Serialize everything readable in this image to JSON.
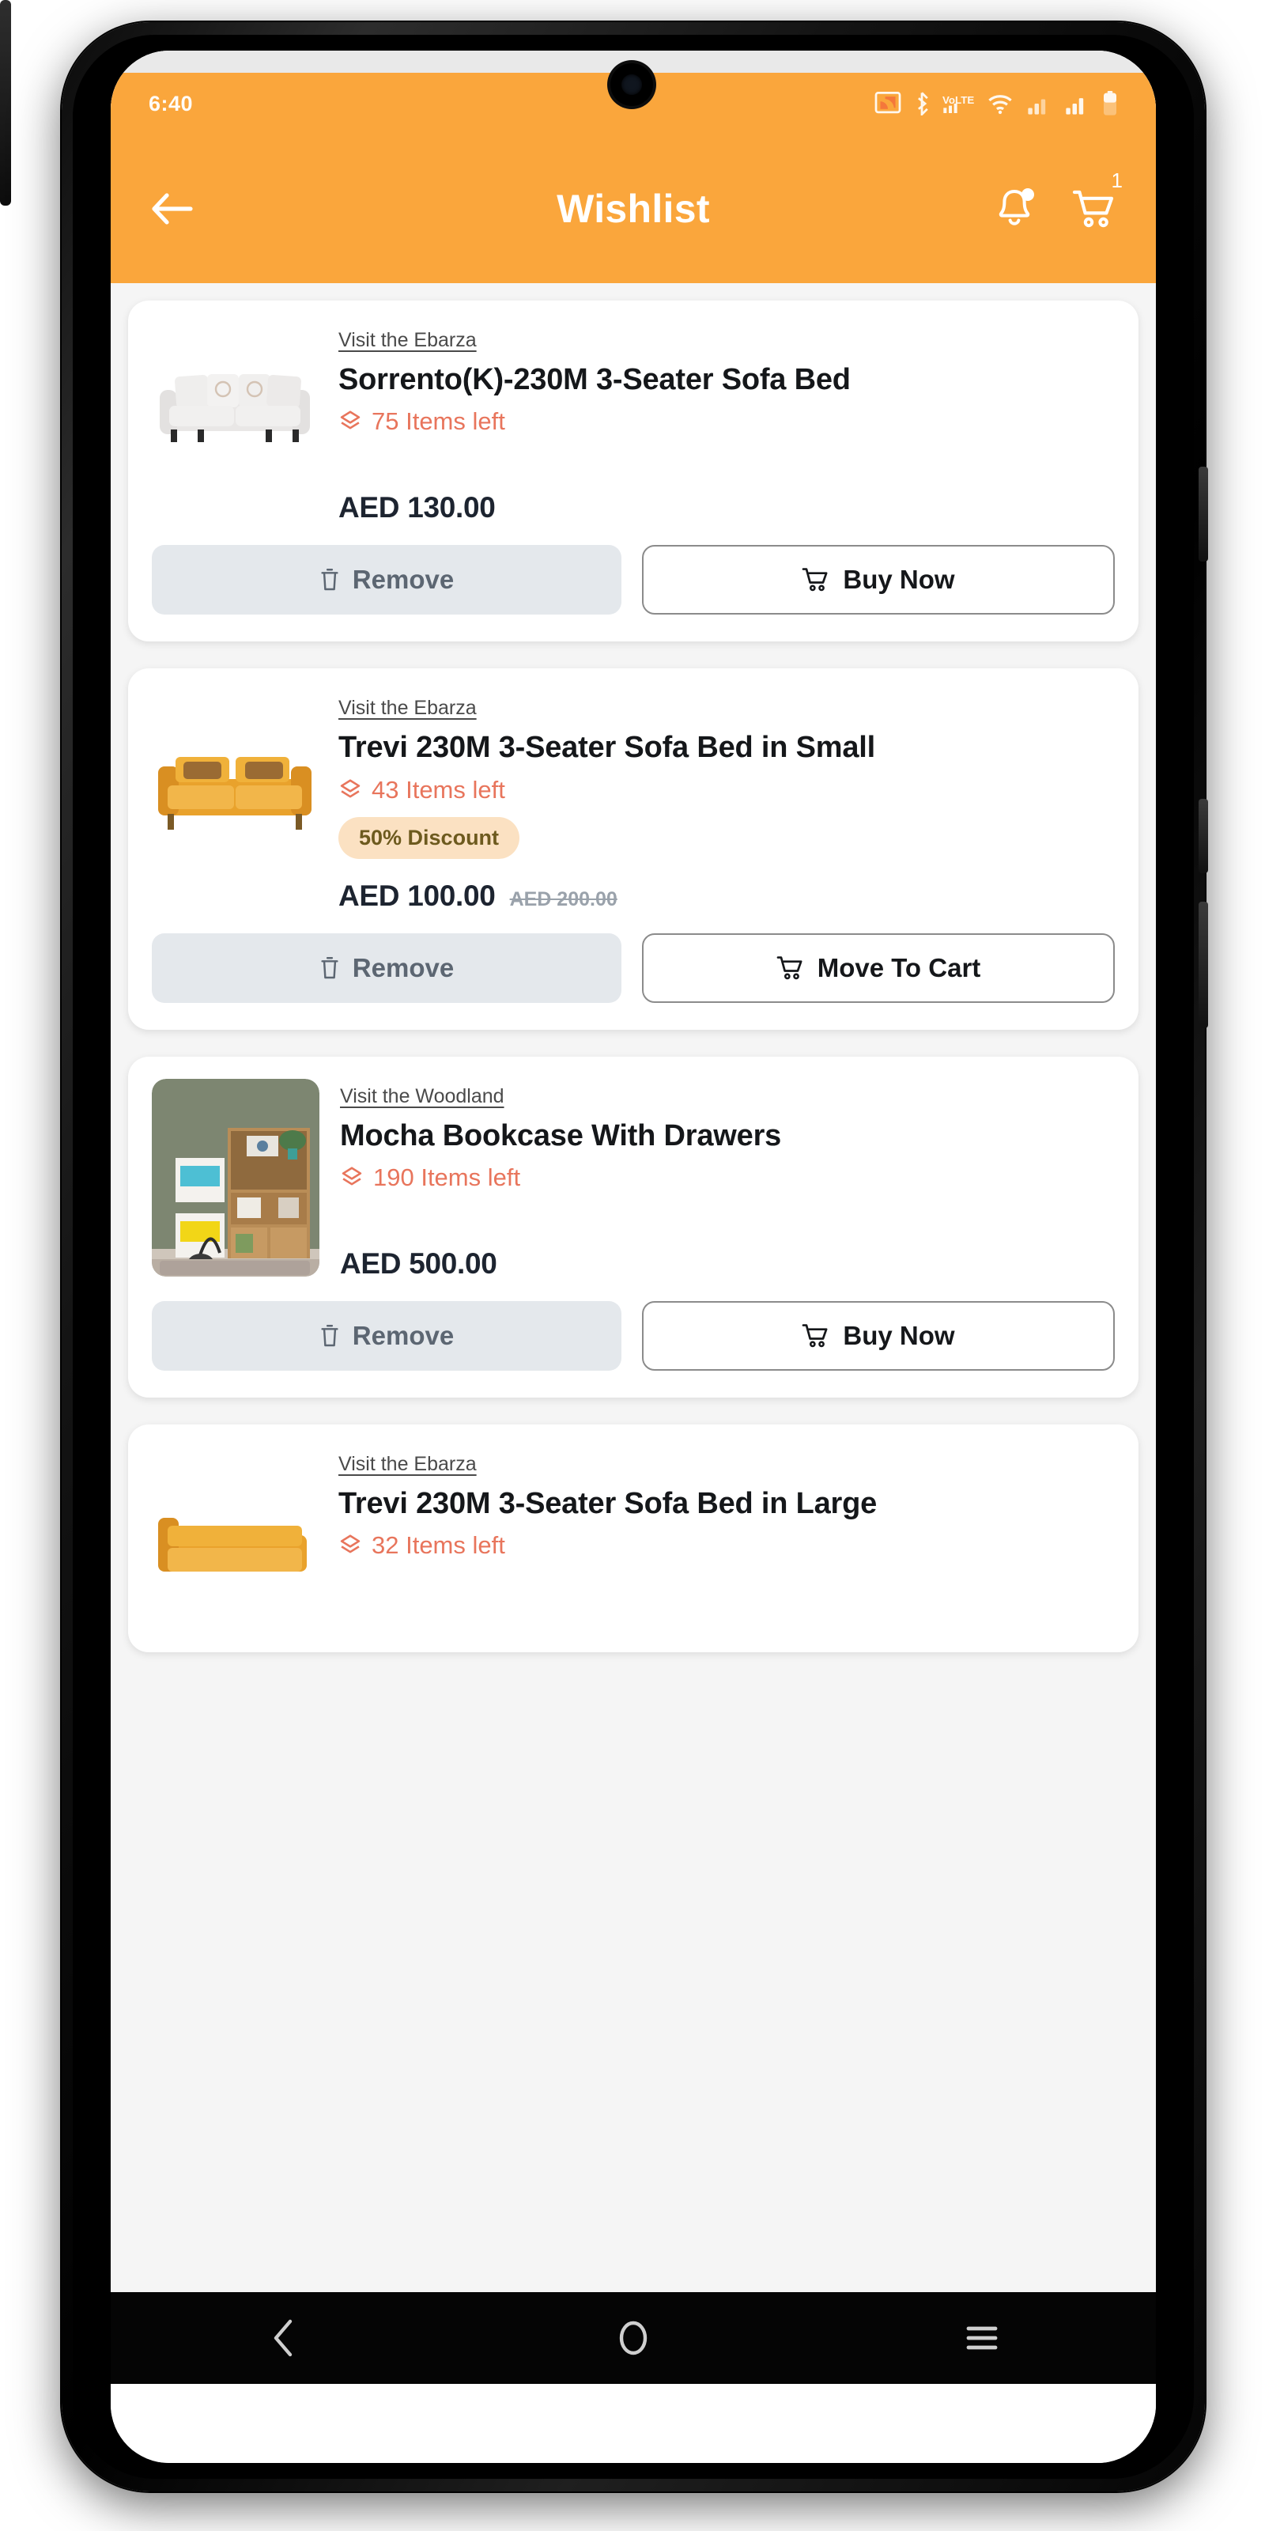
{
  "status_bar": {
    "time": "6:40",
    "icons": [
      "cast-icon",
      "bluetooth-icon",
      "lte-icon",
      "wifi-icon",
      "signal-1-icon",
      "signal-2-icon",
      "battery-icon"
    ]
  },
  "app_bar": {
    "back_icon": "arrow-left-icon",
    "title": "Wishlist",
    "notification_icon": "bell-icon",
    "cart_icon": "cart-icon",
    "cart_badge": "1"
  },
  "theme": {
    "primary": "#faa63c",
    "stock_text": "#e8755c",
    "discount_bg": "#fbe1c2",
    "discount_text": "#6d5a1e",
    "remove_bg": "#e4e8ec",
    "page_bg": "#f5f5f5",
    "price_text": "#1d2430"
  },
  "buttons": {
    "remove_label": "Remove",
    "buy_now_label": "Buy Now",
    "move_to_cart_label": "Move To Cart"
  },
  "wishlist": {
    "items": [
      {
        "store": "Visit the Ebarza",
        "title": "Sorrento(K)-230M 3-Seater Sofa Bed",
        "stock": "75 Items left",
        "discount": null,
        "price": "AED 130.00",
        "old_price": null,
        "primary_action": "Buy Now",
        "remove_action": "Remove",
        "image": "white-sofa"
      },
      {
        "store": "Visit the Ebarza",
        "title": "Trevi 230M 3-Seater Sofa Bed in Small",
        "stock": "43 Items left",
        "discount": "50% Discount",
        "price": "AED 100.00",
        "old_price": "AED 200.00",
        "primary_action": "Move To Cart",
        "remove_action": "Remove",
        "image": "yellow-sofa"
      },
      {
        "store": "Visit the Woodland",
        "title": "Mocha Bookcase With Drawers",
        "stock": "190 Items left",
        "discount": null,
        "price": "AED 500.00",
        "old_price": null,
        "primary_action": "Buy Now",
        "remove_action": "Remove",
        "image": "bookcase-room"
      },
      {
        "store": "Visit the Ebarza",
        "title": "Trevi 230M 3-Seater Sofa Bed in Large",
        "stock": "32 Items left",
        "discount": null,
        "price": null,
        "old_price": null,
        "primary_action": null,
        "remove_action": null,
        "image": "yellow-sofa"
      }
    ]
  },
  "nav_bar": {
    "back": "back-chevron-icon",
    "home": "home-circle-icon",
    "recents": "menu-lines-icon"
  }
}
